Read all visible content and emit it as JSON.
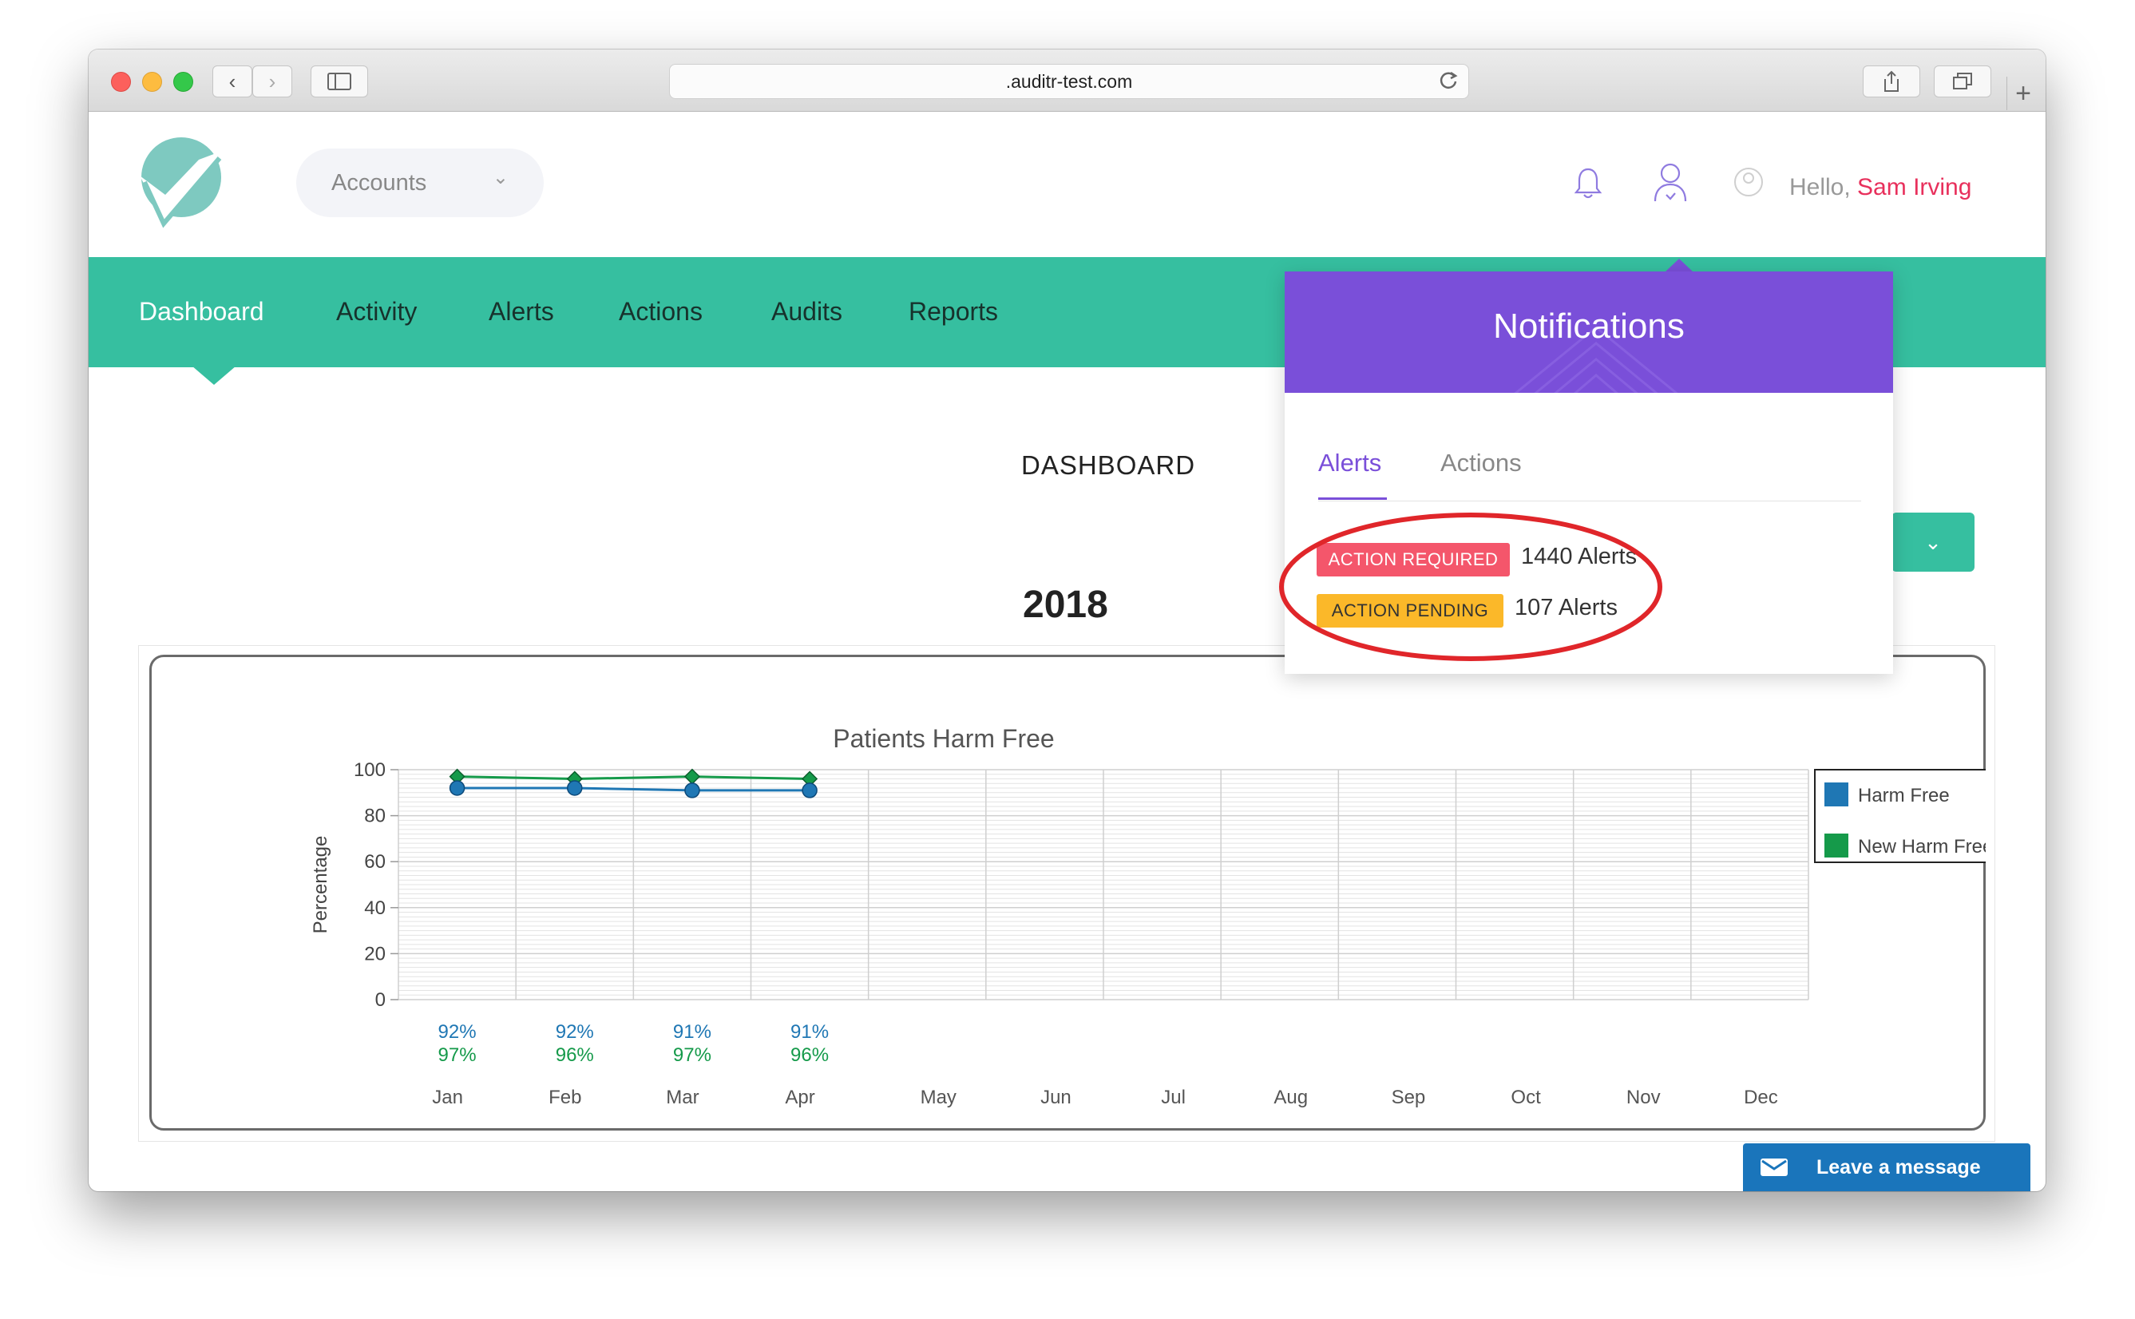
{
  "browser": {
    "url": ".auditr-test.com"
  },
  "header": {
    "accounts_label": "Accounts",
    "greeting": "Hello,",
    "user_name": "Sam Irving"
  },
  "nav": {
    "items": [
      "Dashboard",
      "Activity",
      "Alerts",
      "Actions",
      "Audits",
      "Reports"
    ],
    "active": "Dashboard"
  },
  "page": {
    "title": "DASHBOARD",
    "year": "2018"
  },
  "notifications": {
    "title": "Notifications",
    "tabs": [
      "Alerts",
      "Actions"
    ],
    "active_tab": "Alerts",
    "rows": [
      {
        "badge": "ACTION REQUIRED",
        "count": "1440 Alerts",
        "badge_color": "#f4566b"
      },
      {
        "badge": "ACTION PENDING",
        "count": "107 Alerts",
        "badge_color": "#fbb829"
      }
    ]
  },
  "chart_data": {
    "type": "line",
    "title": "Patients Harm Free",
    "xlabel": "",
    "ylabel": "Percentage",
    "ylim": [
      0,
      100
    ],
    "yticks": [
      "0",
      "20",
      "40",
      "60",
      "80",
      "100"
    ],
    "categories": [
      "Jan",
      "Feb",
      "Mar",
      "Apr",
      "May",
      "Jun",
      "Jul",
      "Aug",
      "Sep",
      "Oct",
      "Nov",
      "Dec"
    ],
    "series": [
      {
        "name": "Harm Free",
        "color": "#1f77b4",
        "values": [
          92,
          92,
          91,
          91
        ],
        "labels": [
          "92%",
          "92%",
          "91%",
          "91%"
        ]
      },
      {
        "name": "New Harm Free",
        "color": "#159a4a",
        "values": [
          97,
          96,
          97,
          96
        ],
        "labels": [
          "97%",
          "96%",
          "97%",
          "96%"
        ]
      }
    ],
    "legend": "right",
    "grid": true
  },
  "chat": {
    "label": "Leave a message"
  },
  "colors": {
    "brand": "#36bfa0",
    "notifications": "#7a4fd9",
    "user_name": "#e8305c"
  }
}
